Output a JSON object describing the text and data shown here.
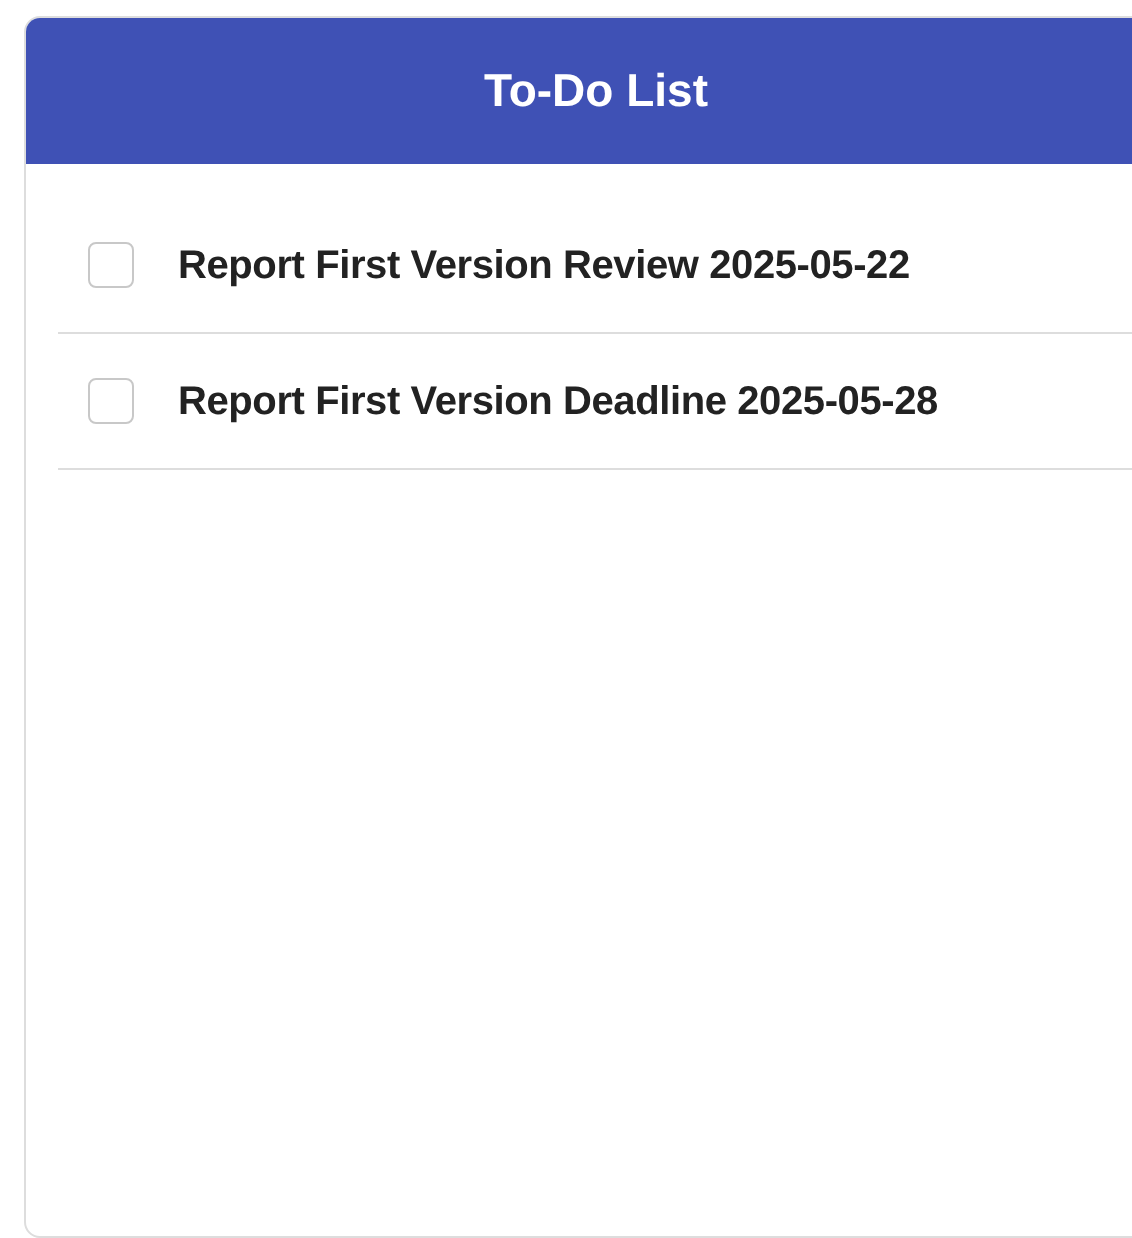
{
  "header": {
    "title": "To-Do List"
  },
  "tasks": [
    {
      "text": "Report First Version Review 2025-05-22",
      "checked": false
    },
    {
      "text": "Report First Version Deadline 2025-05-28",
      "checked": false
    }
  ]
}
